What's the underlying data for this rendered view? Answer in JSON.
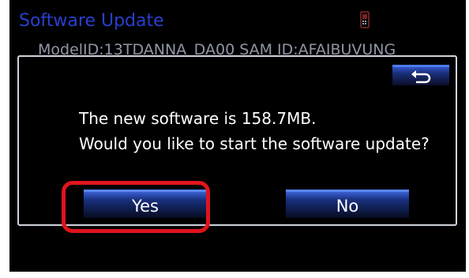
{
  "header": {
    "title": "Software Update",
    "status_icon": "phone-icon",
    "model_line": "ModelID:13TDANNA_DA00   SAM ID:AFAIBUVUNG"
  },
  "dialog": {
    "back_icon": "return-arrow-icon",
    "message_line1": "The new software is 158.7MB.",
    "message_line2": "Would you like to start the software update?",
    "yes_label": "Yes",
    "no_label": "No"
  },
  "colors": {
    "title": "#2a3fd0",
    "button_accent": "#3a5fd2",
    "highlight": "#e0141c",
    "background": "#000000"
  }
}
